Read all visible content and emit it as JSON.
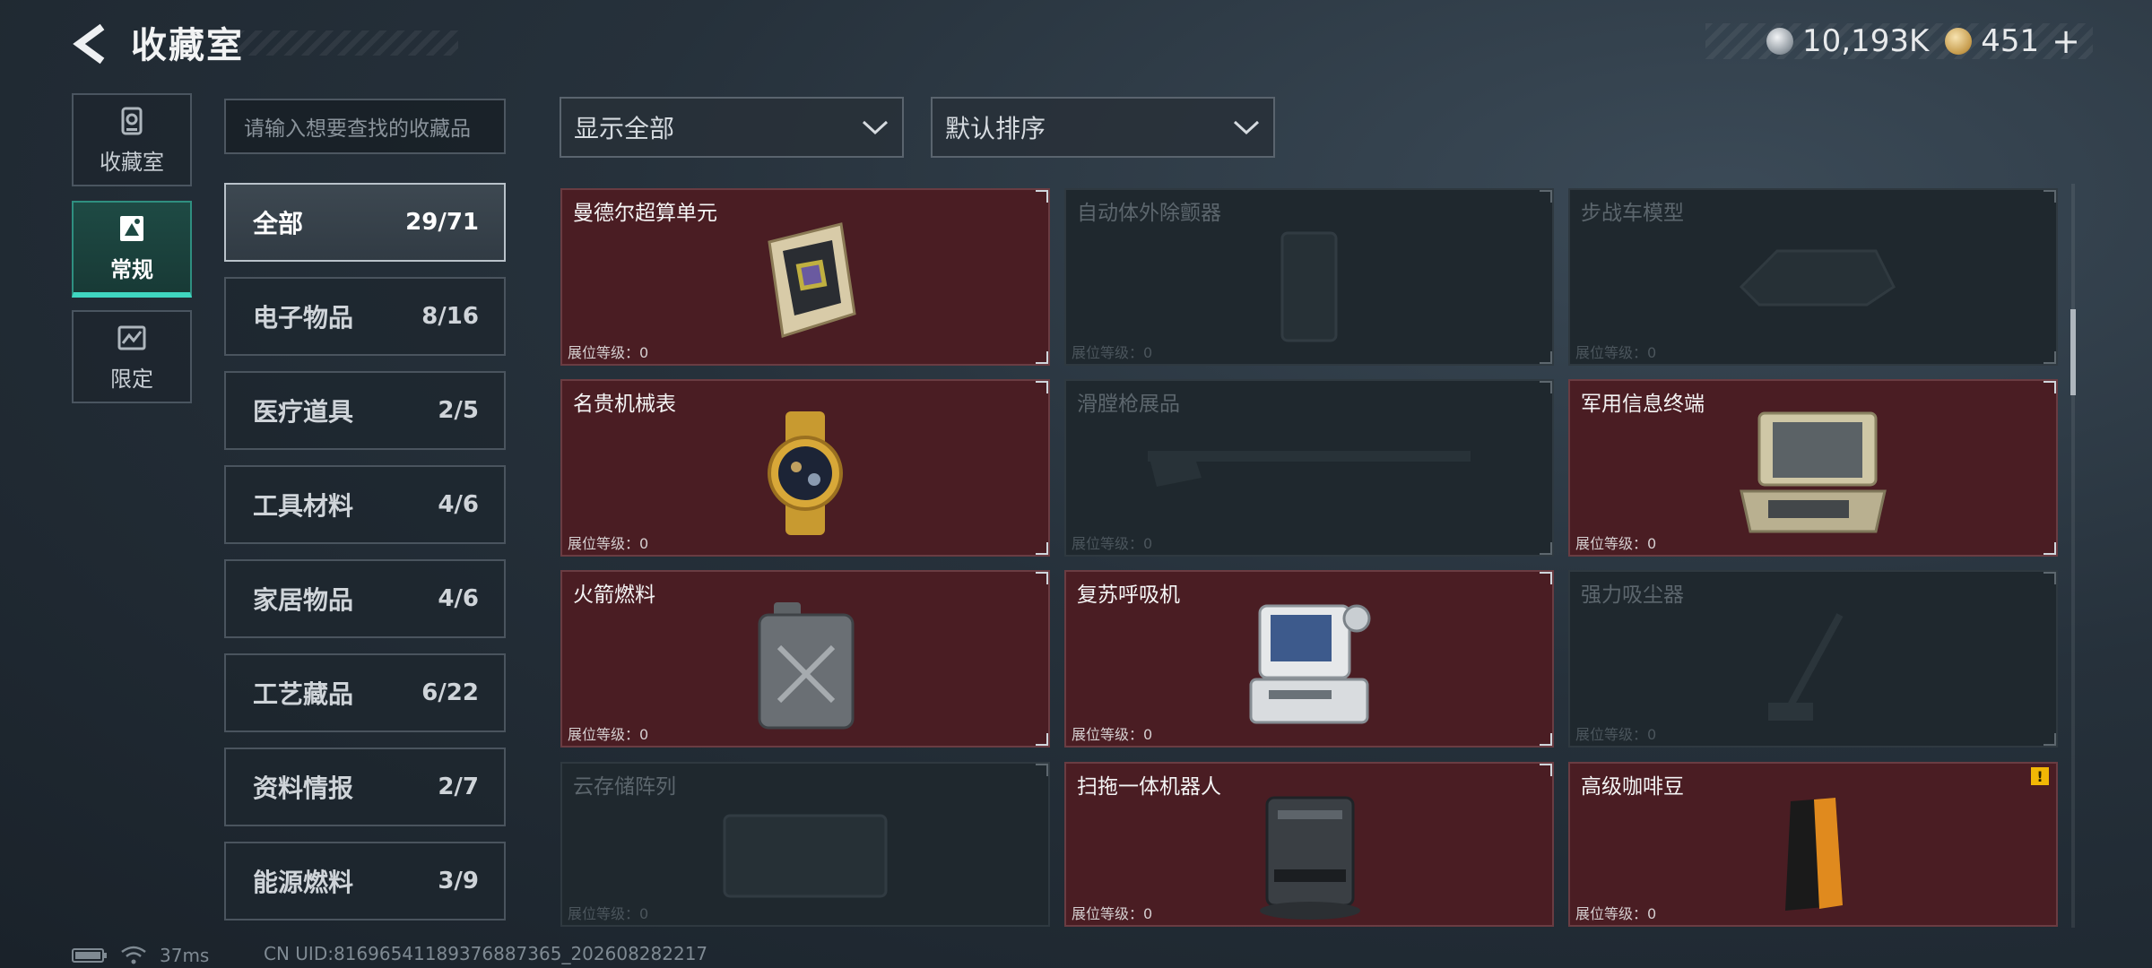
{
  "header": {
    "title": "收藏室",
    "currency": [
      {
        "icon": "silver-coin-icon",
        "value": "10,193K"
      },
      {
        "icon": "gold-coin-icon",
        "value": "451"
      }
    ],
    "plus_label": "+"
  },
  "nav": [
    {
      "label": "收藏室",
      "icon": "vault-icon",
      "active": false
    },
    {
      "label": "常规",
      "icon": "card-icon",
      "active": true
    },
    {
      "label": "限定",
      "icon": "limited-icon",
      "active": false
    }
  ],
  "search": {
    "placeholder": "请输入想要查找的收藏品"
  },
  "filters": {
    "show": "显示全部",
    "sort": "默认排序"
  },
  "categories": [
    {
      "name": "全部",
      "count": "29/71",
      "active": true
    },
    {
      "name": "电子物品",
      "count": "8/16"
    },
    {
      "name": "医疗道具",
      "count": "2/5"
    },
    {
      "name": "工具材料",
      "count": "4/6"
    },
    {
      "name": "家居物品",
      "count": "4/6"
    },
    {
      "name": "工艺藏品",
      "count": "6/22"
    },
    {
      "name": "资料情报",
      "count": "2/7"
    },
    {
      "name": "能源燃料",
      "count": "3/9"
    }
  ],
  "level_label": "展位等级：0",
  "items": [
    {
      "name": "曼德尔超算单元",
      "owned": true,
      "art": "supercomputer-unit"
    },
    {
      "name": "自动体外除颤器",
      "owned": false,
      "art": "defibrillator"
    },
    {
      "name": "步战车模型",
      "owned": false,
      "art": "ifv-model"
    },
    {
      "name": "名贵机械表",
      "owned": true,
      "art": "luxury-watch"
    },
    {
      "name": "滑膛枪展品",
      "owned": false,
      "art": "musket-exhibit"
    },
    {
      "name": "军用信息终端",
      "owned": true,
      "art": "military-terminal"
    },
    {
      "name": "火箭燃料",
      "owned": true,
      "art": "rocket-fuel-can"
    },
    {
      "name": "复苏呼吸机",
      "owned": true,
      "art": "resuscitator"
    },
    {
      "name": "强力吸尘器",
      "owned": false,
      "art": "vacuum-cleaner"
    },
    {
      "name": "云存储阵列",
      "owned": false,
      "art": "cloud-storage-array"
    },
    {
      "name": "扫拖一体机器人",
      "owned": true,
      "art": "mop-robot"
    },
    {
      "name": "高级咖啡豆",
      "owned": true,
      "art": "coffee-beans",
      "alert": "!"
    }
  ],
  "footer": {
    "ping": "37ms",
    "uid": "CN UID:81696541189376887365_202608282217"
  },
  "colors": {
    "accent": "#3fd6c0",
    "owned_card": "#4a1d23",
    "locked_card": "#1f282e",
    "alert": "#f2b705"
  }
}
